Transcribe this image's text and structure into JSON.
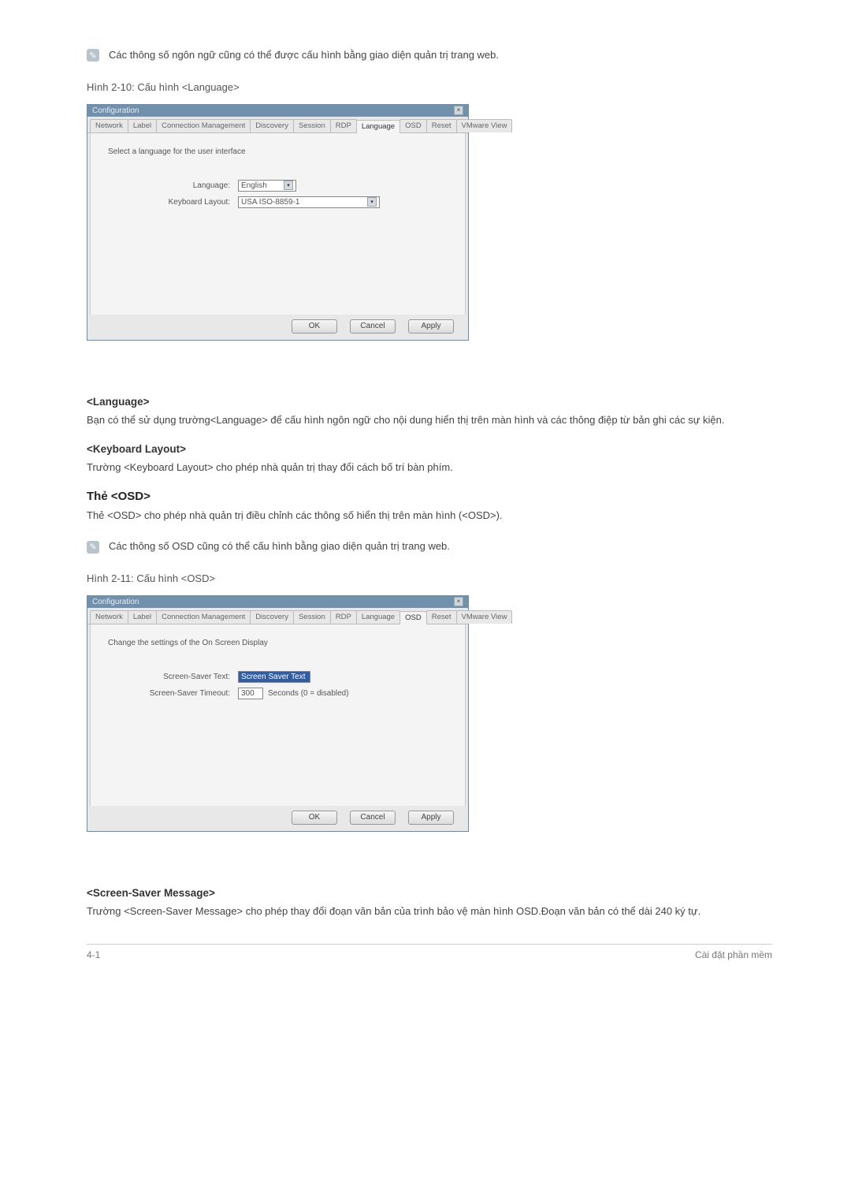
{
  "note1": "Các thông số ngôn ngữ cũng có thể được cấu hình bằng giao diện quản trị trang web.",
  "caption1": "Hình 2-10: Cấu hình <Language>",
  "dialog_common": {
    "title": "Configuration",
    "close_glyph": "×",
    "tabs": [
      "Network",
      "Label",
      "Connection Management",
      "Discovery",
      "Session",
      "RDP",
      "Language",
      "OSD",
      "Reset",
      "VMware View"
    ],
    "buttons": {
      "ok": "OK",
      "cancel": "Cancel",
      "apply": "Apply"
    }
  },
  "dlg1": {
    "desc": "Select a language for the user interface",
    "lang_label": "Language:",
    "lang_value": "English",
    "kb_label": "Keyboard Layout:",
    "kb_value": "USA ISO-8859-1"
  },
  "sec_lang_h": "<Language>",
  "sec_lang_p": "Bạn có thể sử dụng trường<Language> để cấu hình ngôn ngữ cho nội dung hiển thị trên màn hình và các thông điệp từ bản ghi các sự kiện.",
  "sec_kb_h": "<Keyboard Layout>",
  "sec_kb_p": "Trường <Keyboard Layout> cho phép nhà quản trị thay đổi cách bố trí bàn phím.",
  "tab_osd_h": "Thẻ <OSD>",
  "tab_osd_p": "Thẻ <OSD> cho phép nhà quản trị điều chỉnh các thông số hiển thị trên màn hình (<OSD>).",
  "note2": "Các thông số OSD cũng có thể cấu hình bằng giao diện quản trị trang web.",
  "caption2": "Hình 2-11: Cấu hình <OSD>",
  "dlg2": {
    "desc": "Change the settings of the On Screen Display",
    "sstext_label": "Screen-Saver Text:",
    "sstext_value": "Screen Saver Text",
    "ssto_label": "Screen-Saver Timeout:",
    "ssto_value": "300",
    "ssto_after": "Seconds (0 = disabled)"
  },
  "sec_ss_h": "<Screen-Saver Message>",
  "sec_ss_p": "Trường <Screen-Saver Message> cho phép thay đổi đoạn văn bản của trình bảo vệ màn hình OSD.Đoạn văn bản có thể dài 240 ký tự.",
  "footer": {
    "left": "4-1",
    "right": "Cài đặt phần mềm"
  }
}
